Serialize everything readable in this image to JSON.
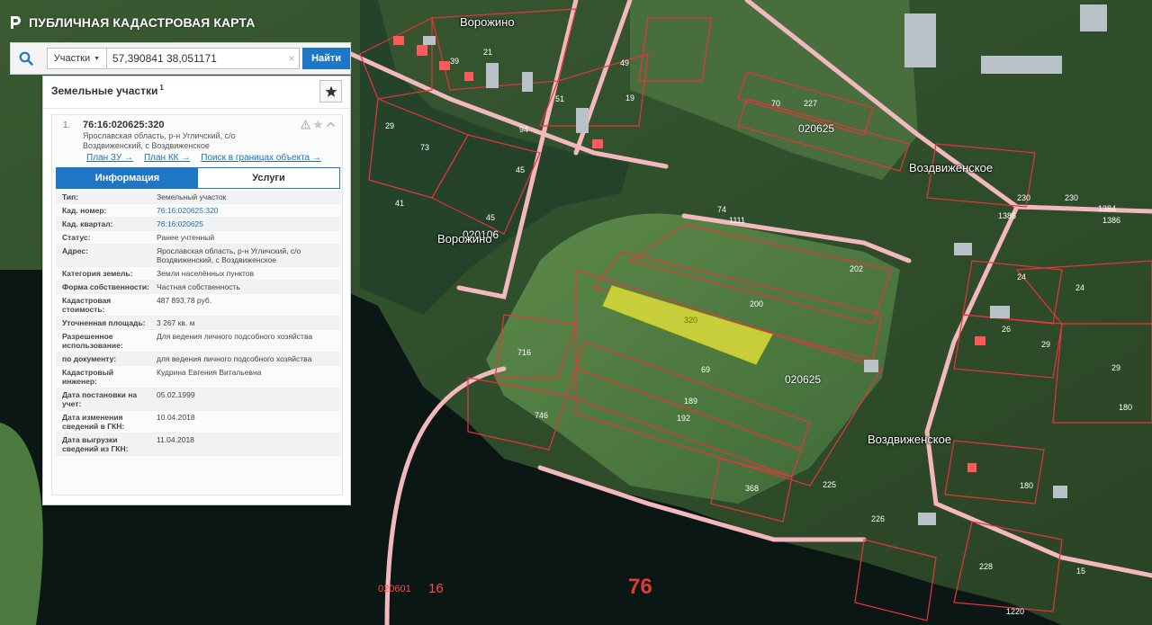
{
  "header": {
    "title": "ПУБЛИЧНАЯ КАДАСТРОВАЯ КАРТА",
    "logo_icon": "pkk-logo-icon"
  },
  "search": {
    "type_label": "Участки",
    "value": "57,390841 38,051171",
    "submit_label": "Найти",
    "clear_symbol": "×"
  },
  "panel": {
    "title": "Земельные участки",
    "count": "1",
    "result": {
      "index": "1.",
      "cad_number": "76:16:020625:320",
      "address": "Ярославская область, р-н Угличский, с/о Воздвиженский, с Воздвиженское",
      "links": [
        "План ЗУ →",
        "План КК →",
        "Поиск в границах объекта →"
      ],
      "tabs": [
        "Информация",
        "Услуги"
      ],
      "info": [
        {
          "key": "Тип:",
          "value": "Земельный участок"
        },
        {
          "key": "Кад. номер:",
          "value": "76:16:020625:320"
        },
        {
          "key": "Кад. квартал:",
          "value": "76:16:020625"
        },
        {
          "key": "Статус:",
          "value": "Ранее учтенный"
        },
        {
          "key": "Адрес:",
          "value": "Ярославская область, р-н Угличский, с/о Воздвиженский, с Воздвиженское"
        },
        {
          "key": "Категория земель:",
          "value": "Земли населённых пунктов"
        },
        {
          "key": "Форма собственности:",
          "value": "Частная собственность"
        },
        {
          "key": "Кадастровая стоимость:",
          "value": "487 893,78 руб."
        },
        {
          "key": "Уточненная площадь:",
          "value": "3 267 кв. м"
        },
        {
          "key": "Разрешенное использование:",
          "value": "Для ведения личного подсобного хозяйства"
        },
        {
          "key": "по документу:",
          "value": "для ведения личного подсобного хозяйства"
        },
        {
          "key": "Кадастровый инженер:",
          "value": "Кудрина Евгения Витальевна"
        },
        {
          "key": "Дата постановки на учет:",
          "value": "05.02.1999"
        },
        {
          "key": "Дата изменения сведений в ГКН:",
          "value": "10.04.2018"
        },
        {
          "key": "Дата выгрузки сведений из ГКН:",
          "value": "11.04.2018"
        }
      ]
    }
  },
  "map": {
    "selected_parcel": "320",
    "places": [
      "Ворожино",
      "Ворожино",
      "Воздвиженское",
      "Воздвиженское"
    ],
    "quarters": [
      "020625",
      "020625",
      "020106"
    ],
    "zone_code": "020601",
    "zone_number": "16",
    "region_number": "76",
    "parcel_numbers": [
      "49",
      "39",
      "21",
      "51",
      "19",
      "94",
      "29",
      "73",
      "45",
      "45",
      "70",
      "227",
      "74",
      "1111",
      "202",
      "200",
      "69",
      "189",
      "192",
      "716",
      "746",
      "368",
      "225",
      "226",
      "230",
      "230",
      "1384",
      "1386",
      "1386",
      "24",
      "24",
      "26",
      "29",
      "29",
      "180",
      "180",
      "228",
      "1220",
      "15",
      "41"
    ],
    "colors": {
      "boundary": "#e8343a",
      "road": "#f2b8bd",
      "selected_fill": "#dcde3a",
      "water": "#0a1512",
      "tab_active": "#1f76c5"
    }
  }
}
